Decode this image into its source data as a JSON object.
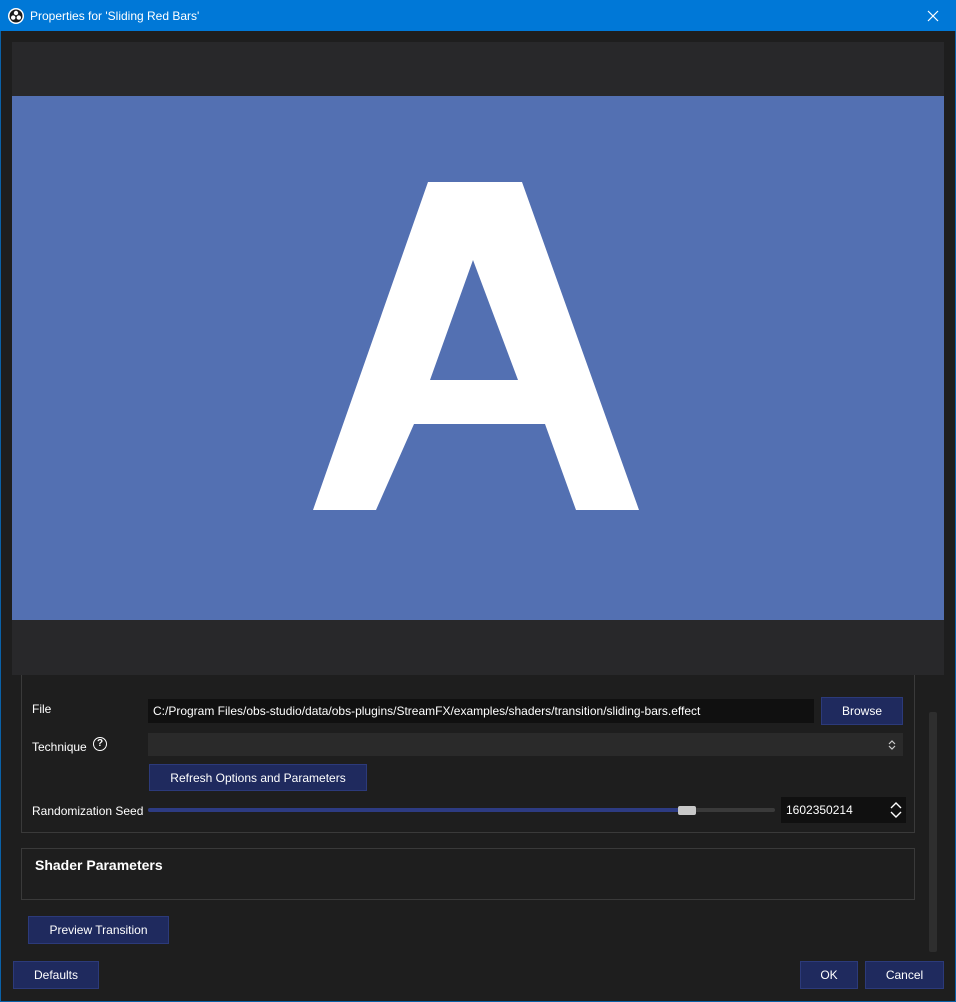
{
  "window": {
    "title": "Properties for 'Sliding Red Bars'",
    "app_icon": "obs-logo-icon",
    "close_icon": "close-icon",
    "accent_color": "#0078d7"
  },
  "preview": {
    "background_color": "#5370b2",
    "letter": "A"
  },
  "properties": {
    "file": {
      "label": "File",
      "value": "C:/Program Files/obs-studio/data/obs-plugins/StreamFX/examples/shaders/transition/sliding-bars.effect",
      "browse_label": "Browse"
    },
    "technique": {
      "label": "Technique",
      "help_icon": "help-icon",
      "value": ""
    },
    "refresh_label": "Refresh Options and Parameters",
    "seed": {
      "label": "Randomization Seed",
      "value": "1602350214",
      "slider_fraction": 0.86
    }
  },
  "shader_parameters": {
    "title": "Shader Parameters"
  },
  "preview_transition_label": "Preview Transition",
  "footer": {
    "defaults_label": "Defaults",
    "ok_label": "OK",
    "cancel_label": "Cancel"
  }
}
